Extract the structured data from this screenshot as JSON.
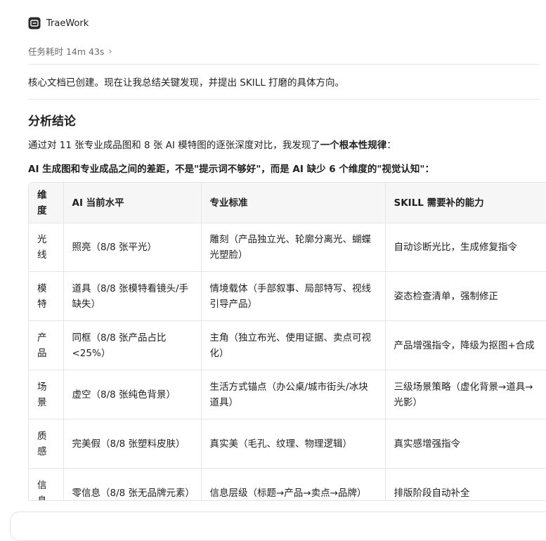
{
  "header": {
    "app_name": "TraeWork"
  },
  "timing": {
    "label": "任务耗时 14m 43s",
    "chevron": "›"
  },
  "messages": {
    "p1": "核心文档已创建。现在让我总结关键发现，并提出 SKILL 打磨的具体方向。",
    "heading": "分析结论",
    "p2_prefix": "通过对 11 张专业成品图和 8 张 AI 模特图的逐张深度对比，我发现了",
    "p2_bold": "一个根本性规律",
    "p2_suffix": "：",
    "p3": "AI 生成图和专业成品之间的差距，不是\"提示词不够好\"，而是 AI 缺少 6 个维度的\"视觉认知\"："
  },
  "table": {
    "headers": [
      "维度",
      "AI 当前水平",
      "专业标准",
      "SKILL 需要补的能力"
    ],
    "rows": [
      [
        "光线",
        "照亮（8/8 张平光）",
        "雕刻（产品独立光、轮廓分离光、蝴蝶光塑脸）",
        "自动诊断光比，生成修复指令"
      ],
      [
        "模特",
        "道具（8/8 张模特看镜头/手缺失）",
        "情境载体（手部叙事、局部特写、视线引导产品）",
        "姿态检查清单，强制修正"
      ],
      [
        "产品",
        "同框（8/8 张产品占比<25%）",
        "主角（独立布光、使用证据、卖点可视化）",
        "产品增强指令，降级为抠图+合成"
      ],
      [
        "场景",
        "虚空（8/8 张纯色背景）",
        "生活方式锚点（办公桌/城市街头/冰块道具）",
        "三级场景策略（虚化背景→道具→光影）"
      ],
      [
        "质感",
        "完美假（8/8 张塑料皮肤）",
        "真实美（毛孔、纹理、物理逻辑）",
        "真实感增强指令"
      ],
      [
        "信息",
        "零信息（8/8 张无品牌元素）",
        "信息层级（标题→产品→卖点→品牌）",
        "排版阶段自动补全"
      ]
    ]
  }
}
